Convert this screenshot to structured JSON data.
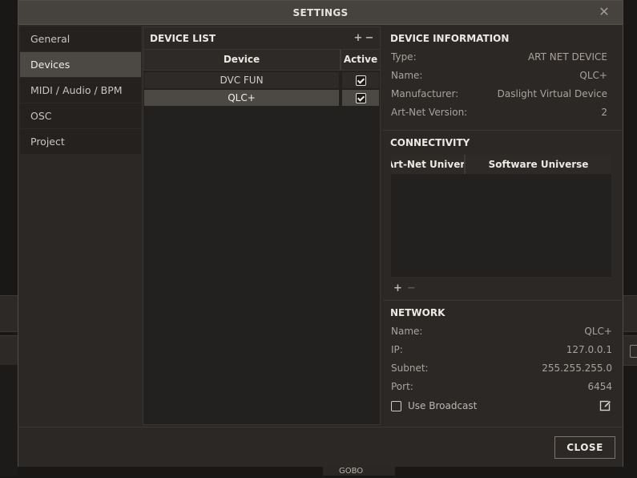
{
  "dialog": {
    "title": "SETTINGS",
    "close_label": "CLOSE"
  },
  "sidebar": {
    "items": [
      {
        "label": "General",
        "active": false
      },
      {
        "label": "Devices",
        "active": true
      },
      {
        "label": "MIDI / Audio / BPM",
        "active": false
      },
      {
        "label": "OSC",
        "active": false
      },
      {
        "label": "Project",
        "active": false
      }
    ]
  },
  "device_list": {
    "title": "DEVICE LIST",
    "add": "+",
    "remove": "−",
    "columns": {
      "device": "Device",
      "active": "Active"
    },
    "rows": [
      {
        "device": "DVC FUN",
        "active": true,
        "selected": false
      },
      {
        "device": "QLC+",
        "active": true,
        "selected": true
      }
    ]
  },
  "device_info": {
    "title": "DEVICE INFORMATION",
    "type_label": "Type:",
    "type_value": "ART NET DEVICE",
    "name_label": "Name:",
    "name_value": "QLC+",
    "manufacturer_label": "Manufacturer:",
    "manufacturer_value": "Daslight Virtual Device",
    "artnet_label": "Art-Net Version:",
    "artnet_value": "2"
  },
  "connectivity": {
    "title": "CONNECTIVITY",
    "col_artnet": "Art-Net Universe",
    "col_software": "Software Universe",
    "add": "+",
    "remove": "−"
  },
  "network": {
    "title": "NETWORK",
    "name_label": "Name:",
    "name_value": "QLC+",
    "ip_label": "IP:",
    "ip_value": "127.0.0.1",
    "subnet_label": "Subnet:",
    "subnet_value": "255.255.255.0",
    "port_label": "Port:",
    "port_value": "6454",
    "broadcast_label": "Use Broadcast",
    "broadcast_checked": false
  },
  "background": {
    "tab_label": "GOBO"
  }
}
